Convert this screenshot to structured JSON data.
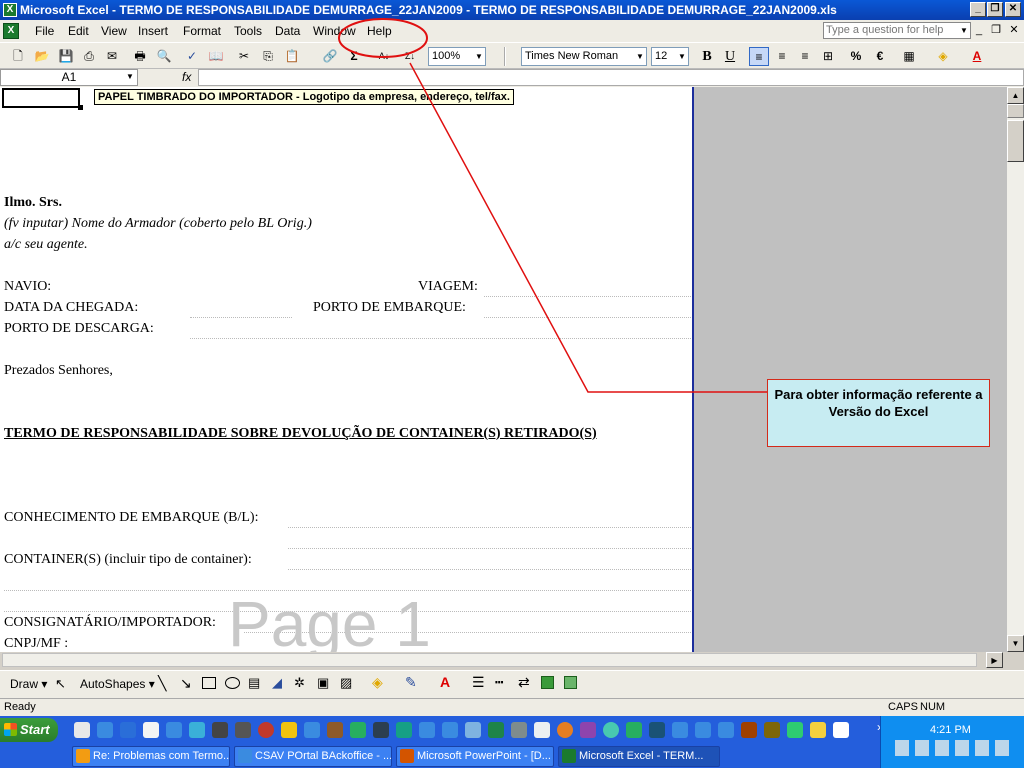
{
  "window": {
    "title": "Microsoft Excel - TERMO DE RESPONSABILIDADE DEMURRAGE_22JAN2009 - TERMO DE RESPONSABILIDADE DEMURRAGE_22JAN2009.xls",
    "app_icon": "X",
    "controls": {
      "minimize": "_",
      "restore": "❐",
      "close": "✕"
    }
  },
  "menu": {
    "items": [
      "File",
      "Edit",
      "View",
      "Insert",
      "Format",
      "Tools",
      "Data",
      "Window",
      "Help"
    ],
    "ask_placeholder": "Type a question for help"
  },
  "toolbar": {
    "zoom": "100%",
    "font_name": "Times New Roman",
    "font_size": "12",
    "bold": "B",
    "underline": "U",
    "percent": "%",
    "euro": "€"
  },
  "formula_bar": {
    "name_box": "A1",
    "fx": "fx"
  },
  "sheet": {
    "comment": "PAPEL TIMBRADO DO IMPORTADOR - Logotipo da empresa, endereço, tel/fax.",
    "greeting_title": "Ilmo. Srs.",
    "armador": "(fv inputar) Nome do Armador (coberto pelo BL Orig.)",
    "agent": "a/c seu agente.",
    "navio": "NAVIO:",
    "viagem": "VIAGEM:",
    "data_chegada": "DATA DA CHEGADA:",
    "porto_embarque": "PORTO DE EMBARQUE:",
    "porto_descarga": "PORTO DE DESCARGA:",
    "prezados": "Prezados Senhores,",
    "termo_title": "TERMO DE RESPONSABILIDADE SOBRE DEVOLUÇÃO DE CONTAINER(S) RETIRADO(S)",
    "conhecimento": "CONHECIMENTO DE EMBARQUE (B/L):",
    "container": "CONTAINER(S) (incluir tipo de container):",
    "consignatario": "CONSIGNATÁRIO/IMPORTADOR:",
    "cnpj": "CNPJ/MF :",
    "page_watermark": "Page 1"
  },
  "callout": {
    "text": "Para obter informação referente a Versão do Excel",
    "border_color": "#d42a1a",
    "fill_color": "#c7ecf2"
  },
  "drawing_toolbar": {
    "draw": "Draw",
    "autoshapes": "AutoShapes"
  },
  "status": {
    "left": "Ready",
    "caps": "CAPS",
    "num": "NUM"
  },
  "taskbar": {
    "start": "Start",
    "clock": "4:21 PM",
    "tasks": [
      {
        "label": "Re: Problemas com Termo...",
        "active": false
      },
      {
        "label": "CSAV POrtal BAckoffice - ...",
        "active": false
      },
      {
        "label": "Microsoft PowerPoint - [D...",
        "active": false
      },
      {
        "label": "Microsoft Excel - TERM...",
        "active": true
      }
    ]
  }
}
